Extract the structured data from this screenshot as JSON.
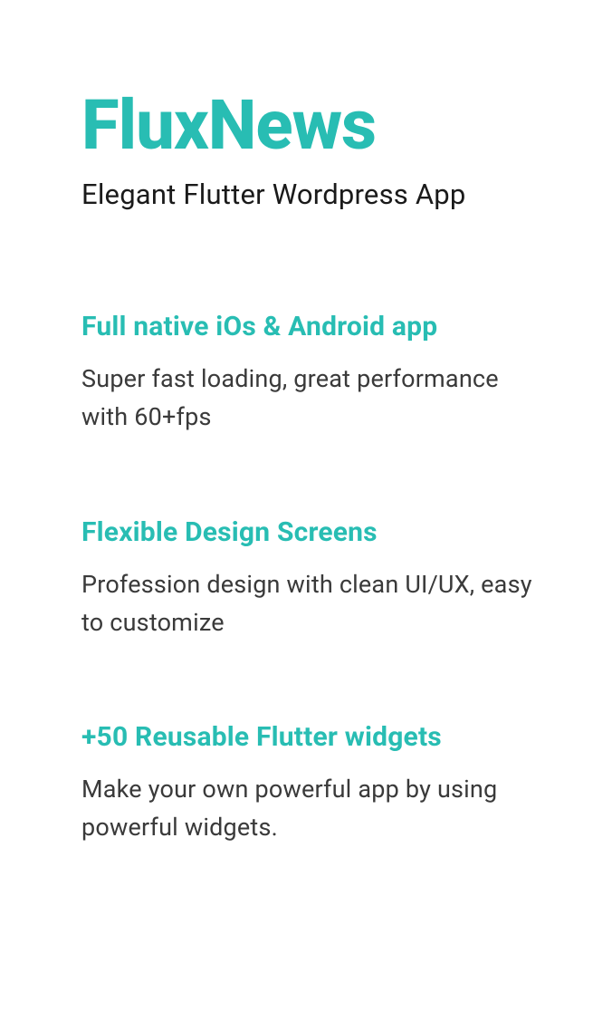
{
  "header": {
    "title": "FluxNews",
    "subtitle": "Elegant Flutter Wordpress App"
  },
  "features": [
    {
      "title": "Full native iOs & Android app",
      "description": "Super fast loading, great performance with 60+fps"
    },
    {
      "title": "Flexible Design Screens",
      "description": "Profession design with clean UI/UX, easy to customize"
    },
    {
      "title": "+50 Reusable Flutter widgets",
      "description": "Make your own powerful app by using powerful widgets."
    }
  ]
}
